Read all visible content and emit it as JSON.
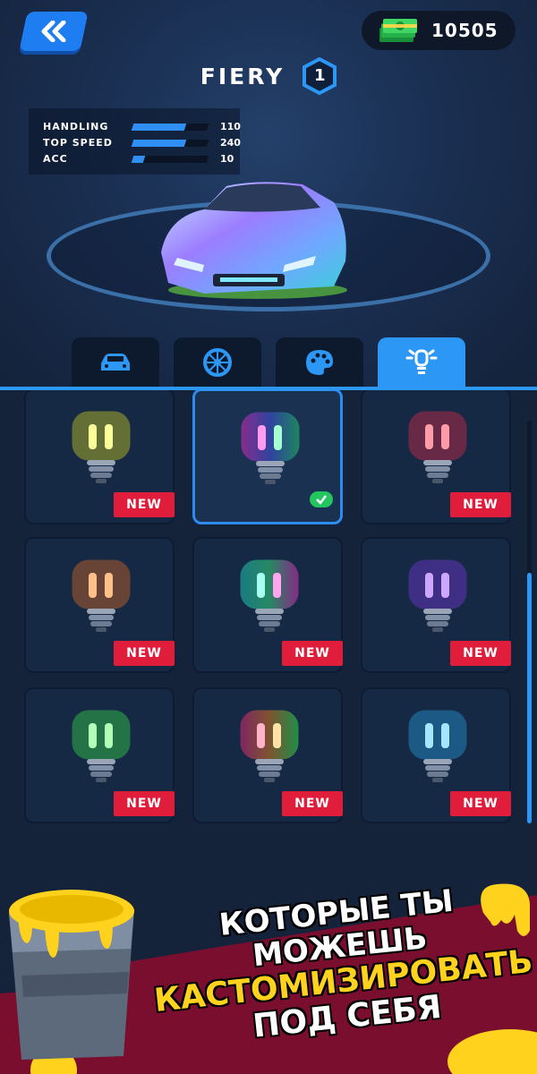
{
  "currency": {
    "amount": "10505",
    "icon": "cash-stack-icon"
  },
  "car": {
    "name": "FIERY",
    "level": "1"
  },
  "stats": [
    {
      "label": "HANDLING",
      "value": "110",
      "fill_pct": 70
    },
    {
      "label": "TOP SPEED",
      "value": "240",
      "fill_pct": 70
    },
    {
      "label": "ACC",
      "value": "10",
      "fill_pct": 15
    }
  ],
  "tabs": [
    {
      "name": "car-body",
      "icon": "car-icon",
      "active": false
    },
    {
      "name": "wheels",
      "icon": "wheel-icon",
      "active": false
    },
    {
      "name": "paint",
      "icon": "palette-icon",
      "active": false
    },
    {
      "name": "lights",
      "icon": "light-bulb-icon",
      "active": true
    }
  ],
  "items": [
    {
      "color": "#f4f21c",
      "badge": "NEW",
      "selected": false
    },
    {
      "color": "rainbow",
      "badge": "",
      "selected": true
    },
    {
      "color": "#ff2b4a",
      "badge": "NEW",
      "selected": false
    },
    {
      "color": "#ff7a1a",
      "badge": "NEW",
      "selected": false
    },
    {
      "color": "rainbow-green",
      "badge": "NEW",
      "selected": false
    },
    {
      "color": "#8a3dff",
      "badge": "NEW",
      "selected": false
    },
    {
      "color": "#3dff4a",
      "badge": "NEW",
      "selected": false
    },
    {
      "color": "rainbow-warm",
      "badge": "NEW",
      "selected": false
    },
    {
      "color": "#2ab8ff",
      "badge": "NEW",
      "selected": false
    }
  ],
  "promo": {
    "line1": "КОТОРЫЕ ТЫ",
    "line2": "МОЖЕШЬ",
    "line3": "КАСТОМИЗИРОВАТЬ",
    "line4": "ПОД СЕБЯ"
  },
  "colors": {
    "accent": "#2c97f5",
    "badge": "#e11d3c",
    "panel": "#152844",
    "promo_band": "#7a0e2e",
    "paint_yellow": "#ffd21e"
  }
}
